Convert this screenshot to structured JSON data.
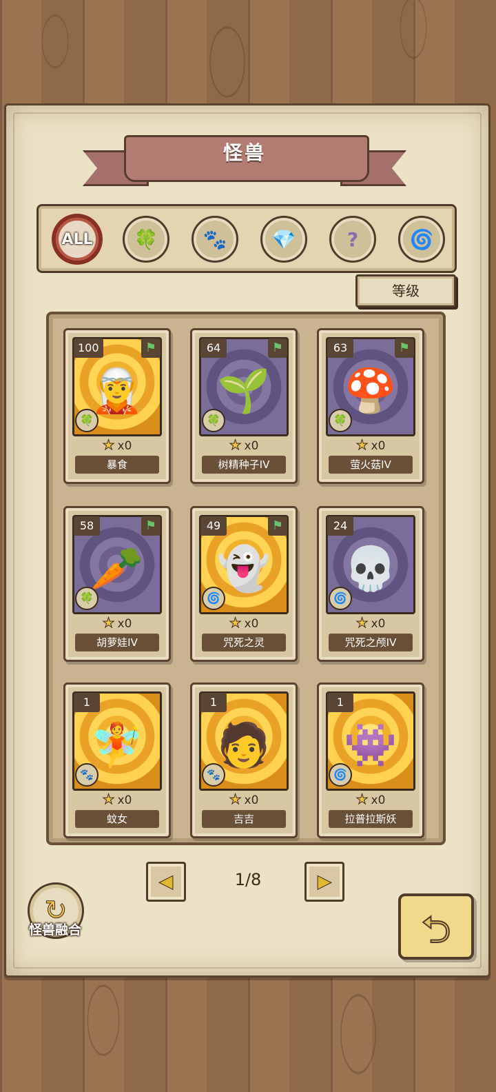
{
  "title": "怪兽",
  "filters": [
    {
      "label": "ALL",
      "icon": "all-icon",
      "active": true
    },
    {
      "icon": "leaf-icon",
      "active": false
    },
    {
      "icon": "paw-icon",
      "active": false
    },
    {
      "icon": "crystal-icon",
      "active": false
    },
    {
      "icon": "question-icon",
      "active": false
    },
    {
      "icon": "spiral-icon",
      "active": false
    }
  ],
  "sort_label": "等级",
  "cards": [
    {
      "level": "100",
      "name": "暴食",
      "count": "x0",
      "bg": "gold",
      "type": "leaf",
      "flag": true
    },
    {
      "level": "64",
      "name": "树精种子IV",
      "count": "x0",
      "bg": "purple",
      "type": "leaf",
      "flag": true
    },
    {
      "level": "63",
      "name": "萤火菇IV",
      "count": "x0",
      "bg": "purple",
      "type": "leaf",
      "flag": true
    },
    {
      "level": "58",
      "name": "胡萝娃IV",
      "count": "x0",
      "bg": "purple",
      "type": "leaf",
      "flag": true
    },
    {
      "level": "49",
      "name": "咒死之灵",
      "count": "x0",
      "bg": "gold",
      "type": "spiral",
      "flag": true
    },
    {
      "level": "24",
      "name": "咒死之颅IV",
      "count": "x0",
      "bg": "purple",
      "type": "spiral",
      "flag": false
    },
    {
      "level": "1",
      "name": "蚊女",
      "count": "x0",
      "bg": "gold",
      "type": "paw",
      "flag": false
    },
    {
      "level": "1",
      "name": "吉吉",
      "count": "x0",
      "bg": "gold",
      "type": "paw",
      "flag": false
    },
    {
      "level": "1",
      "name": "拉普拉斯妖",
      "count": "x0",
      "bg": "gold",
      "type": "spiral",
      "flag": false
    }
  ],
  "pager": {
    "text": "1/8",
    "prev": "◀",
    "next": "▶"
  },
  "fusion_label": "怪兽融合",
  "icons": {
    "leaf": "🍀",
    "paw": "🐾",
    "spiral": "🌀",
    "flag": "⚑",
    "star": "★"
  }
}
